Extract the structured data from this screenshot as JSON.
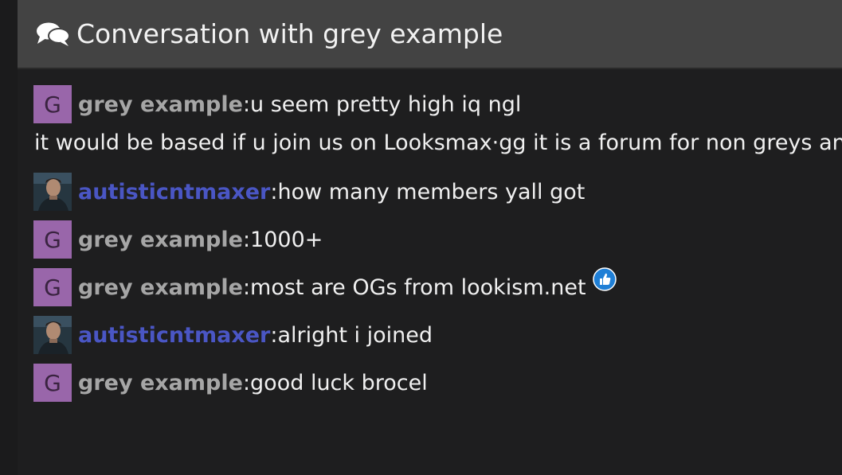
{
  "header": {
    "title": "Conversation with grey example",
    "icon": "comments-icon"
  },
  "colors": {
    "header_bg": "#434343",
    "page_bg": "#1e1e1f",
    "avatar_bg": "#9966aa",
    "grey_author": "#a6a6a6",
    "blue_author": "#4a56c4"
  },
  "messages": [
    {
      "author": "grey example",
      "avatar_letter": "G",
      "separator": ":",
      "text": " u seem pretty high iq ngl",
      "continuation": "it would be based if u join us on Looksmax·gg it is a forum for non greys and"
    },
    {
      "author": "autisticntmaxer",
      "avatar_letter": "",
      "separator": ":",
      "text": " how many members yall got"
    },
    {
      "author": "grey example",
      "avatar_letter": "G",
      "separator": ":",
      "text": " 1000+"
    },
    {
      "author": "grey example",
      "avatar_letter": "G",
      "separator": ":",
      "text": " most are OGs from lookism.net",
      "emoji": "thumbs-up-icon"
    },
    {
      "author": "autisticntmaxer",
      "avatar_letter": "",
      "separator": ":",
      "text": " alright i joined"
    },
    {
      "author": "grey example",
      "avatar_letter": "G",
      "separator": ":",
      "text": " good luck brocel"
    }
  ]
}
